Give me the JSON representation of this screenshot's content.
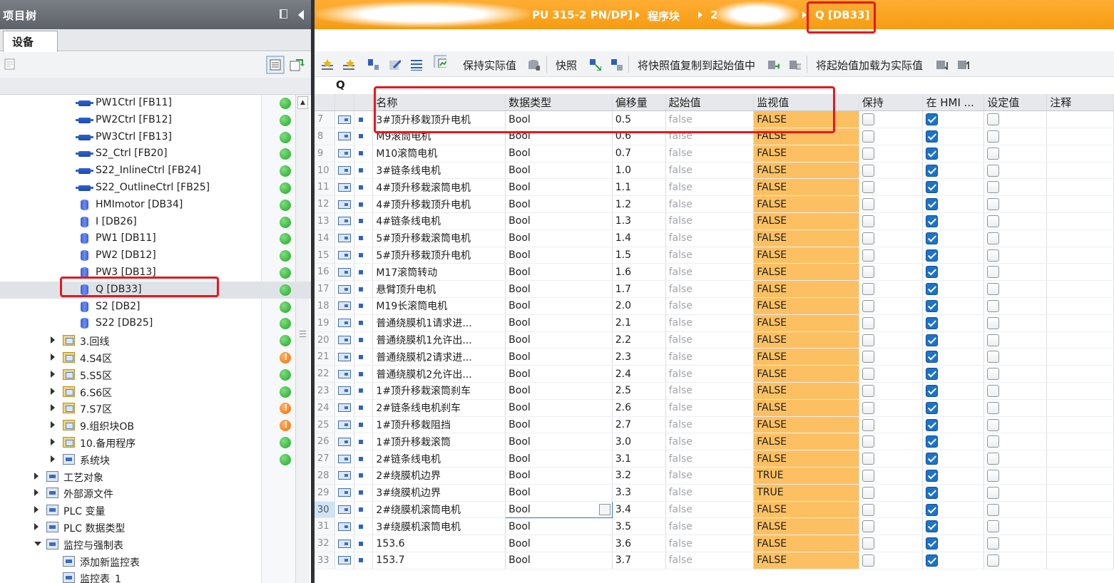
{
  "project_tree": {
    "title": "项目树",
    "tab": "设备",
    "items": [
      {
        "label": "PW1Ctrl [FB11]",
        "icon": "fb-icon",
        "status": "ok"
      },
      {
        "label": "PW2Ctrl [FB12]",
        "icon": "fb-icon",
        "status": "ok"
      },
      {
        "label": "PW3Ctrl [FB13]",
        "icon": "fb-icon",
        "status": "ok"
      },
      {
        "label": "S2_Ctrl [FB20]",
        "icon": "fb-icon",
        "status": "ok"
      },
      {
        "label": "S22_InlineCtrl [FB24]",
        "icon": "fb-icon",
        "status": "ok"
      },
      {
        "label": "S22_OutlineCtrl [FB25]",
        "icon": "fb-icon",
        "status": "ok"
      },
      {
        "label": "HMImotor [DB34]",
        "icon": "db-icon",
        "status": "ok"
      },
      {
        "label": "I [DB26]",
        "icon": "db-icon",
        "status": "ok"
      },
      {
        "label": "PW1 [DB11]",
        "icon": "db-icon",
        "status": "ok"
      },
      {
        "label": "PW2 [DB12]",
        "icon": "db-icon",
        "status": "ok"
      },
      {
        "label": "PW3 [DB13]",
        "icon": "db-icon",
        "status": "ok"
      },
      {
        "label": "Q [DB33]",
        "icon": "db-icon",
        "status": "ok"
      },
      {
        "label": "S2 [DB2]",
        "icon": "db-icon",
        "status": "ok"
      },
      {
        "label": "S22 [DB25]",
        "icon": "db-icon",
        "status": "ok"
      },
      {
        "label": "3.回线",
        "icon": "folder-icon",
        "status": "ok"
      },
      {
        "label": "4.S4区",
        "icon": "folder-icon",
        "status": "warn"
      },
      {
        "label": "5.S5区",
        "icon": "folder-icon",
        "status": "ok"
      },
      {
        "label": "6.S6区",
        "icon": "folder-icon",
        "status": "ok"
      },
      {
        "label": "7.S7区",
        "icon": "folder-icon",
        "status": "warn"
      },
      {
        "label": "9.组织块OB",
        "icon": "folder-icon",
        "status": "warn"
      },
      {
        "label": "10.备用程序",
        "icon": "folder-icon",
        "status": "ok"
      },
      {
        "label": "系统块",
        "icon": "system-block-icon",
        "status": "ok"
      },
      {
        "label": "工艺对象",
        "icon": "technology-object-icon",
        "status": ""
      },
      {
        "label": "外部源文件",
        "icon": "external-source-icon",
        "status": ""
      },
      {
        "label": "PLC 变量",
        "icon": "plc-tags-icon",
        "status": ""
      },
      {
        "label": "PLC 数据类型",
        "icon": "plc-datatype-icon",
        "status": ""
      },
      {
        "label": "监控与强制表",
        "icon": "watch-table-icon",
        "status": ""
      },
      {
        "label": "添加新监控表",
        "icon": "add-watch-table-icon",
        "status": ""
      },
      {
        "label": "监控表_1",
        "icon": "watch-table-icon",
        "status": ""
      }
    ]
  },
  "breadcrumb": [
    "PU 315-2 PN/DP]",
    "程序块",
    "2",
    "Q [DB33]"
  ],
  "toolbar": {
    "keep_actual": "保持实际值",
    "snapshot": "快照",
    "copy_snapshot": "将快照值复制到起始值中",
    "load_start": "将起始值加载为实际值"
  },
  "db_name": "Q",
  "columns": [
    "名称",
    "数据类型",
    "偏移量",
    "起始值",
    "监视值",
    "保持",
    "在 HMI ...",
    "设定值",
    "注释"
  ],
  "rows": [
    {
      "n": "7",
      "name": "3#顶升移栽顶升电机",
      "type": "Bool",
      "offset": "0.5",
      "start": "false",
      "monitor": "FALSE",
      "hmi": true
    },
    {
      "n": "8",
      "name": "M9滚筒电机",
      "type": "Bool",
      "offset": "0.6",
      "start": "false",
      "monitor": "FALSE",
      "hmi": true
    },
    {
      "n": "9",
      "name": "M10滚筒电机",
      "type": "Bool",
      "offset": "0.7",
      "start": "false",
      "monitor": "FALSE",
      "hmi": true
    },
    {
      "n": "10",
      "name": "3#链条线电机",
      "type": "Bool",
      "offset": "1.0",
      "start": "false",
      "monitor": "FALSE",
      "hmi": true
    },
    {
      "n": "11",
      "name": "4#顶升移栽滚筒电机",
      "type": "Bool",
      "offset": "1.1",
      "start": "false",
      "monitor": "FALSE",
      "hmi": true
    },
    {
      "n": "12",
      "name": "4#顶升移栽顶升电机",
      "type": "Bool",
      "offset": "1.2",
      "start": "false",
      "monitor": "FALSE",
      "hmi": true
    },
    {
      "n": "13",
      "name": "4#链条线电机",
      "type": "Bool",
      "offset": "1.3",
      "start": "false",
      "monitor": "FALSE",
      "hmi": true
    },
    {
      "n": "14",
      "name": "5#顶升移栽滚筒电机",
      "type": "Bool",
      "offset": "1.4",
      "start": "false",
      "monitor": "FALSE",
      "hmi": true
    },
    {
      "n": "15",
      "name": "5#顶升移栽顶升电机",
      "type": "Bool",
      "offset": "1.5",
      "start": "false",
      "monitor": "FALSE",
      "hmi": true
    },
    {
      "n": "16",
      "name": "M17滚筒转动",
      "type": "Bool",
      "offset": "1.6",
      "start": "false",
      "monitor": "FALSE",
      "hmi": true
    },
    {
      "n": "17",
      "name": "悬臂顶升电机",
      "type": "Bool",
      "offset": "1.7",
      "start": "false",
      "monitor": "FALSE",
      "hmi": true
    },
    {
      "n": "18",
      "name": "M19长滚筒电机",
      "type": "Bool",
      "offset": "2.0",
      "start": "false",
      "monitor": "FALSE",
      "hmi": true
    },
    {
      "n": "19",
      "name": "普通绕膜机1请求进...",
      "type": "Bool",
      "offset": "2.1",
      "start": "false",
      "monitor": "FALSE",
      "hmi": true
    },
    {
      "n": "20",
      "name": "普通绕膜机1允许出...",
      "type": "Bool",
      "offset": "2.2",
      "start": "false",
      "monitor": "FALSE",
      "hmi": true
    },
    {
      "n": "21",
      "name": "普通绕膜机2请求进...",
      "type": "Bool",
      "offset": "2.3",
      "start": "false",
      "monitor": "FALSE",
      "hmi": true
    },
    {
      "n": "22",
      "name": "普通绕膜机2允许出...",
      "type": "Bool",
      "offset": "2.4",
      "start": "false",
      "monitor": "FALSE",
      "hmi": true
    },
    {
      "n": "23",
      "name": "1#顶升移栽滚筒刹车",
      "type": "Bool",
      "offset": "2.5",
      "start": "false",
      "monitor": "FALSE",
      "hmi": true
    },
    {
      "n": "24",
      "name": "2#链条线电机刹车",
      "type": "Bool",
      "offset": "2.6",
      "start": "false",
      "monitor": "FALSE",
      "hmi": true
    },
    {
      "n": "25",
      "name": "1#顶升移栽阻挡",
      "type": "Bool",
      "offset": "2.7",
      "start": "false",
      "monitor": "FALSE",
      "hmi": true
    },
    {
      "n": "26",
      "name": "1#顶升移栽滚筒",
      "type": "Bool",
      "offset": "3.0",
      "start": "false",
      "monitor": "FALSE",
      "hmi": true
    },
    {
      "n": "27",
      "name": "2#链条线电机",
      "type": "Bool",
      "offset": "3.1",
      "start": "false",
      "monitor": "FALSE",
      "hmi": true
    },
    {
      "n": "28",
      "name": "2#绕膜机边界",
      "type": "Bool",
      "offset": "3.2",
      "start": "false",
      "monitor": "TRUE",
      "hmi": true
    },
    {
      "n": "29",
      "name": "3#绕膜机边界",
      "type": "Bool",
      "offset": "3.3",
      "start": "false",
      "monitor": "TRUE",
      "hmi": true
    },
    {
      "n": "30",
      "name": "2#绕膜机滚筒电机",
      "type": "Bool",
      "offset": "3.4",
      "start": "false",
      "monitor": "FALSE",
      "hmi": true
    },
    {
      "n": "31",
      "name": "3#绕膜机滚筒电机",
      "type": "Bool",
      "offset": "3.5",
      "start": "false",
      "monitor": "FALSE",
      "hmi": true
    },
    {
      "n": "32",
      "name": "153.6",
      "type": "Bool",
      "offset": "3.6",
      "start": "false",
      "monitor": "FALSE",
      "hmi": true
    },
    {
      "n": "33",
      "name": "153.7",
      "type": "Bool",
      "offset": "3.7",
      "start": "false",
      "monitor": "FALSE",
      "hmi": true
    }
  ],
  "colors": {
    "accent": "#f59c12",
    "monitor_bg": "#fcc062",
    "highlight": "#e8171c"
  }
}
